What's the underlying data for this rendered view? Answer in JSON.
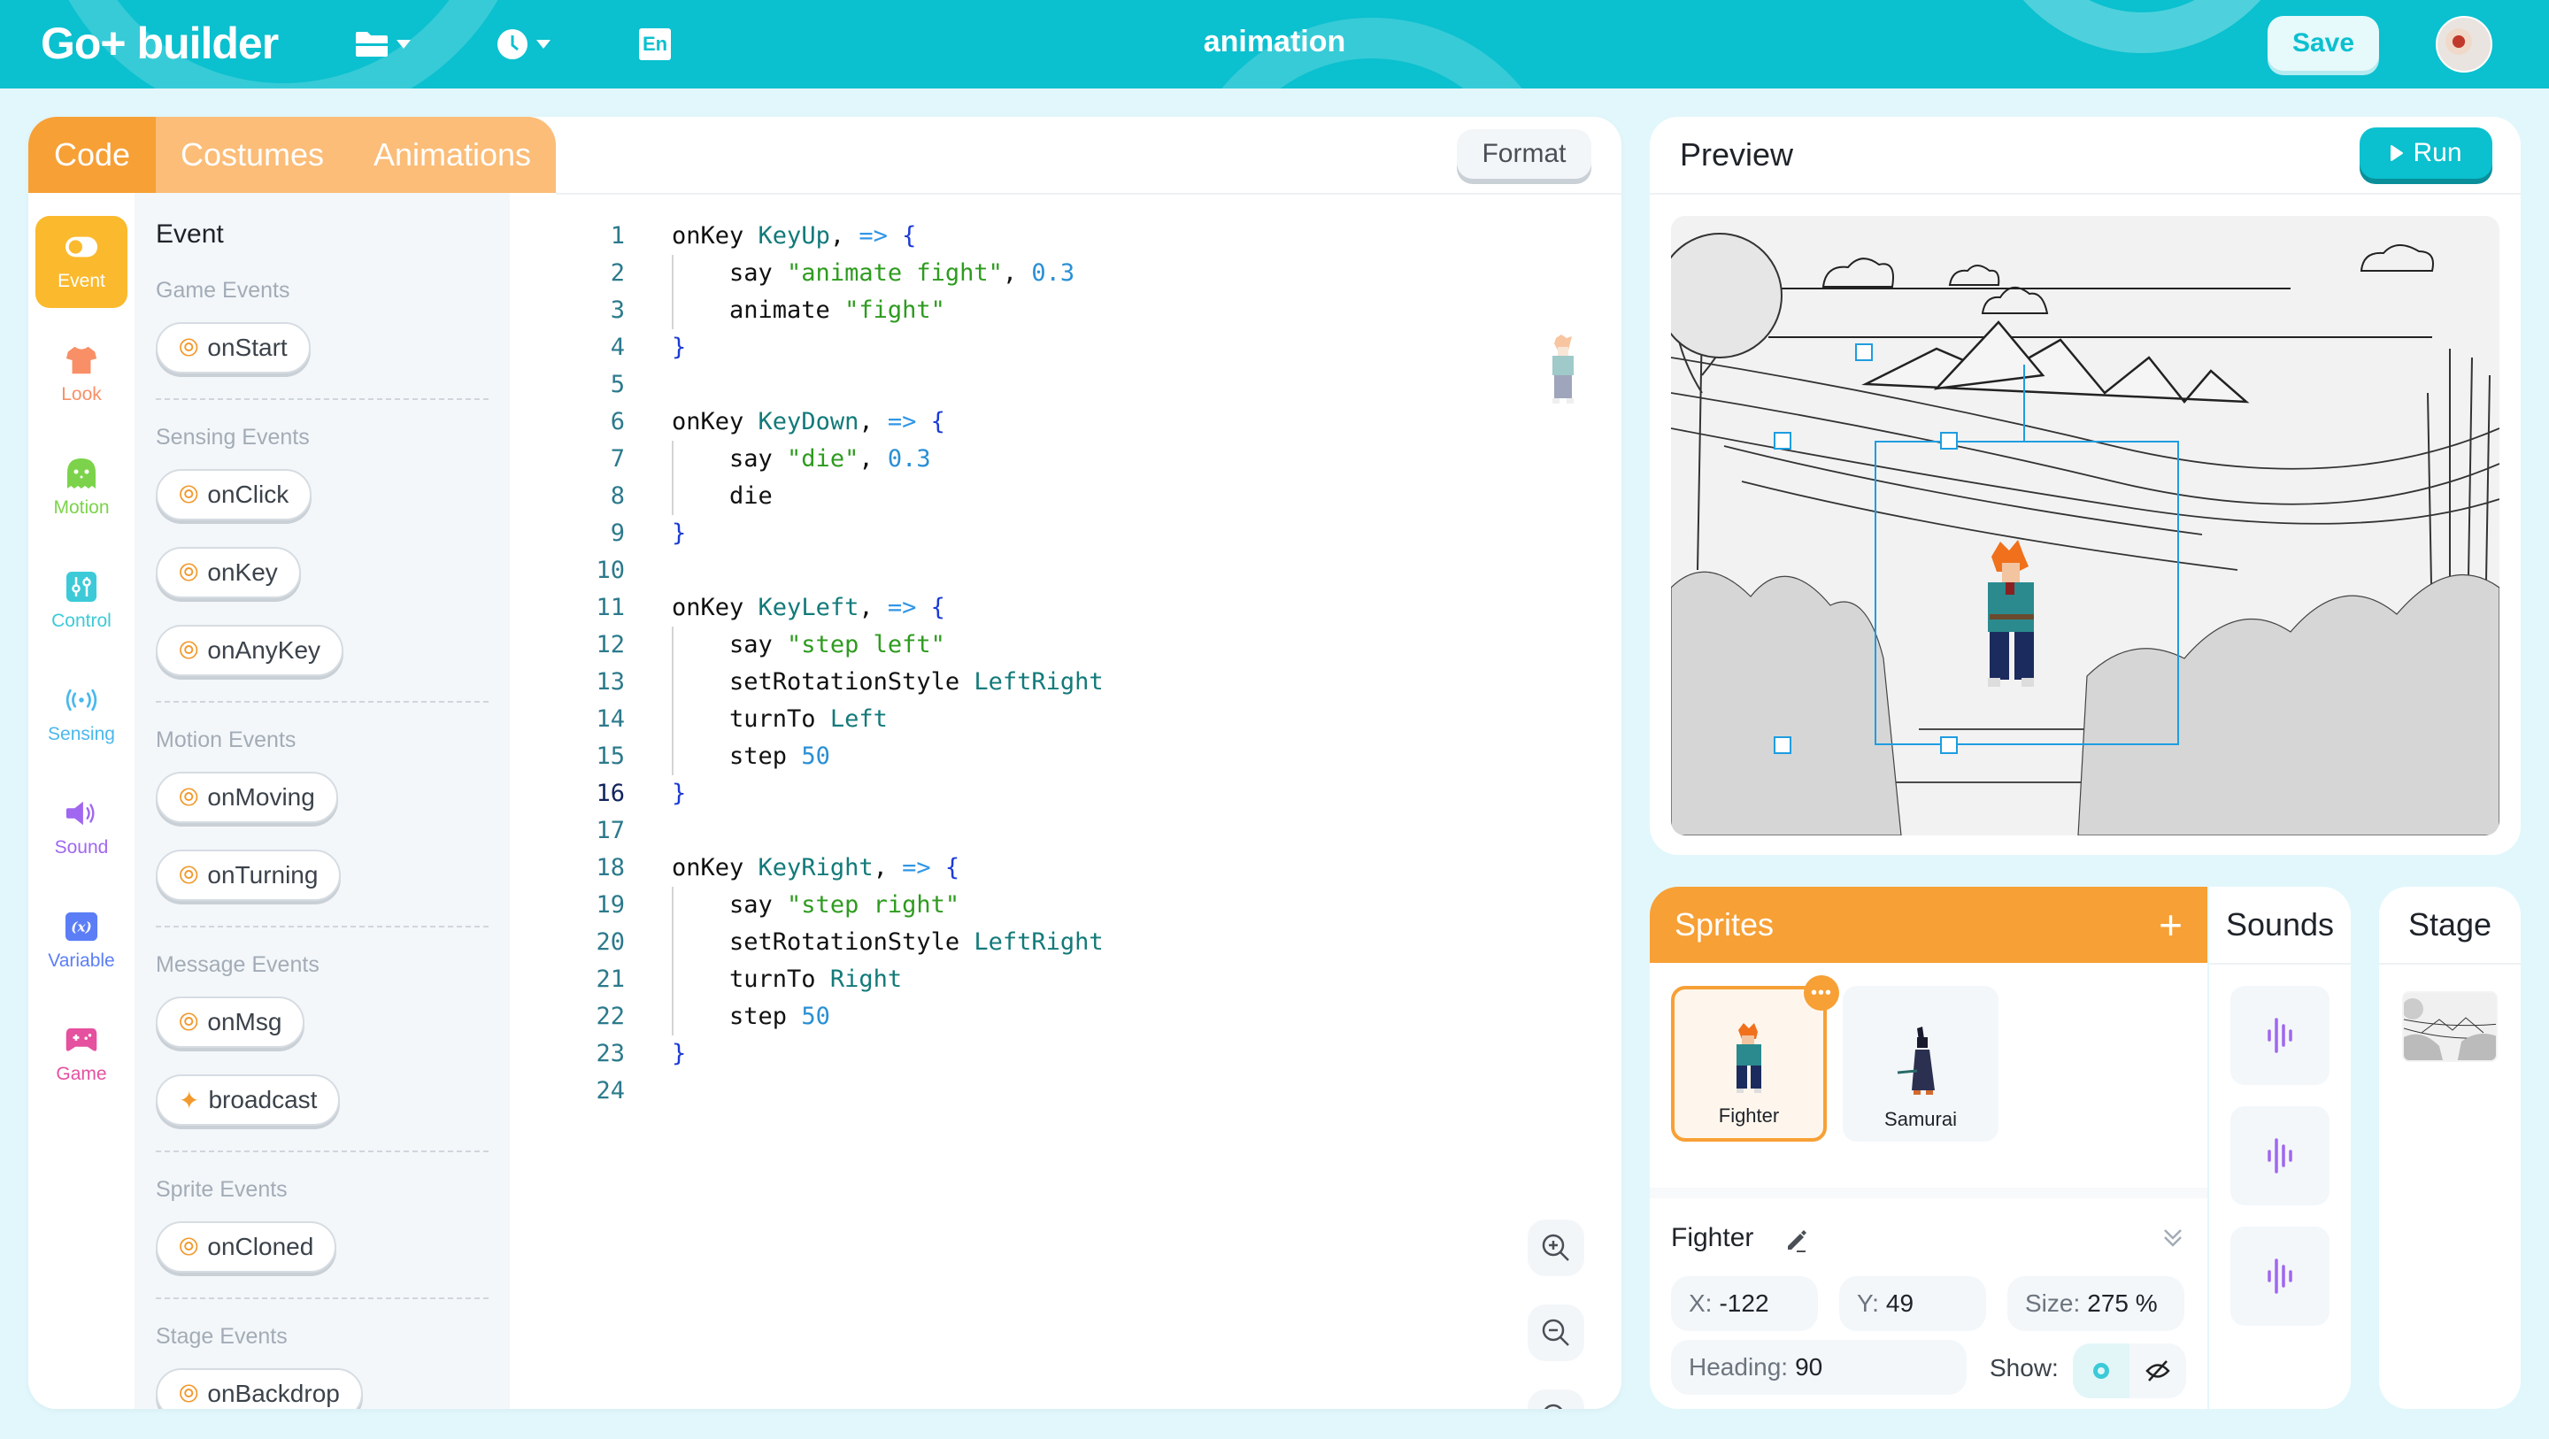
{
  "header": {
    "logo": "Go+ builder",
    "project_title": "animation",
    "language_badge": "En",
    "save_label": "Save",
    "icons": [
      "folder-icon",
      "history-clock-icon",
      "language-icon"
    ]
  },
  "code_panel": {
    "tabs": [
      {
        "label": "Code",
        "active": true
      },
      {
        "label": "Costumes",
        "active": false
      },
      {
        "label": "Animations",
        "active": false
      }
    ],
    "format_label": "Format",
    "categories": [
      {
        "label": "Event",
        "icon": "toggle-icon",
        "color": "#fbb92d",
        "active": true
      },
      {
        "label": "Look",
        "icon": "shirt-icon",
        "color": "#f88f66"
      },
      {
        "label": "Motion",
        "icon": "ghost-icon",
        "color": "#7cd34b"
      },
      {
        "label": "Control",
        "icon": "sliders-icon",
        "color": "#3ccad8"
      },
      {
        "label": "Sensing",
        "icon": "signal-icon",
        "color": "#4ab8ec"
      },
      {
        "label": "Sound",
        "icon": "speaker-icon",
        "color": "#a067f0"
      },
      {
        "label": "Variable",
        "icon": "variable-icon",
        "color": "#5b7ef6"
      },
      {
        "label": "Game",
        "icon": "gamepad-icon",
        "color": "#e5509f"
      }
    ],
    "palette": {
      "title": "Event",
      "sections": [
        {
          "title": "Game Events",
          "blocks": [
            "onStart"
          ]
        },
        {
          "title": "Sensing Events",
          "blocks": [
            "onClick",
            "onKey",
            "onAnyKey"
          ]
        },
        {
          "title": "Motion Events",
          "blocks": [
            "onMoving",
            "onTurning"
          ]
        },
        {
          "title": "Message Events",
          "blocks": [
            "onMsg",
            "broadcast"
          ]
        },
        {
          "title": "Sprite Events",
          "blocks": [
            "onCloned"
          ]
        },
        {
          "title": "Stage Events",
          "blocks": [
            "onBackdrop"
          ]
        }
      ]
    },
    "editor": {
      "current_line": 16,
      "lines": [
        [
          {
            "t": "onKey ",
            "c": "fn"
          },
          {
            "t": "KeyUp",
            "c": "const"
          },
          {
            "t": ", ",
            "c": "fn"
          },
          {
            "t": "=>",
            "c": "op"
          },
          {
            "t": " ",
            "c": "fn"
          },
          {
            "t": "{",
            "c": "brace"
          }
        ],
        [
          {
            "t": "    say ",
            "c": "fn"
          },
          {
            "t": "\"animate fight\"",
            "c": "str"
          },
          {
            "t": ", ",
            "c": "fn"
          },
          {
            "t": "0.3",
            "c": "num"
          }
        ],
        [
          {
            "t": "    animate ",
            "c": "fn"
          },
          {
            "t": "\"fight\"",
            "c": "str"
          }
        ],
        [
          {
            "t": "}",
            "c": "brace"
          }
        ],
        [],
        [
          {
            "t": "onKey ",
            "c": "fn"
          },
          {
            "t": "KeyDown",
            "c": "const"
          },
          {
            "t": ", ",
            "c": "fn"
          },
          {
            "t": "=>",
            "c": "op"
          },
          {
            "t": " ",
            "c": "fn"
          },
          {
            "t": "{",
            "c": "brace"
          }
        ],
        [
          {
            "t": "    say ",
            "c": "fn"
          },
          {
            "t": "\"die\"",
            "c": "str"
          },
          {
            "t": ", ",
            "c": "fn"
          },
          {
            "t": "0.3",
            "c": "num"
          }
        ],
        [
          {
            "t": "    die",
            "c": "fn"
          }
        ],
        [
          {
            "t": "}",
            "c": "brace"
          }
        ],
        [],
        [
          {
            "t": "onKey ",
            "c": "fn"
          },
          {
            "t": "KeyLeft",
            "c": "const"
          },
          {
            "t": ", ",
            "c": "fn"
          },
          {
            "t": "=>",
            "c": "op"
          },
          {
            "t": " ",
            "c": "fn"
          },
          {
            "t": "{",
            "c": "brace"
          }
        ],
        [
          {
            "t": "    say ",
            "c": "fn"
          },
          {
            "t": "\"step left\"",
            "c": "str"
          }
        ],
        [
          {
            "t": "    setRotationStyle ",
            "c": "fn"
          },
          {
            "t": "LeftRight",
            "c": "const"
          }
        ],
        [
          {
            "t": "    turnTo ",
            "c": "fn"
          },
          {
            "t": "Left",
            "c": "const"
          }
        ],
        [
          {
            "t": "    step ",
            "c": "fn"
          },
          {
            "t": "50",
            "c": "num"
          }
        ],
        [
          {
            "t": "}",
            "c": "brace"
          }
        ],
        [],
        [
          {
            "t": "onKey ",
            "c": "fn"
          },
          {
            "t": "KeyRight",
            "c": "const"
          },
          {
            "t": ", ",
            "c": "fn"
          },
          {
            "t": "=>",
            "c": "op"
          },
          {
            "t": " ",
            "c": "fn"
          },
          {
            "t": "{",
            "c": "brace"
          }
        ],
        [
          {
            "t": "    say ",
            "c": "fn"
          },
          {
            "t": "\"step right\"",
            "c": "str"
          }
        ],
        [
          {
            "t": "    setRotationStyle ",
            "c": "fn"
          },
          {
            "t": "LeftRight",
            "c": "const"
          }
        ],
        [
          {
            "t": "    turnTo ",
            "c": "fn"
          },
          {
            "t": "Right",
            "c": "const"
          }
        ],
        [
          {
            "t": "    step ",
            "c": "fn"
          },
          {
            "t": "50",
            "c": "num"
          }
        ],
        [
          {
            "t": "}",
            "c": "brace"
          }
        ],
        []
      ],
      "zoom_controls": [
        "zoom-in-icon",
        "zoom-out-icon",
        "zoom-reset-icon"
      ]
    }
  },
  "preview": {
    "title": "Preview",
    "run_label": "Run"
  },
  "sprites": {
    "title": "Sprites",
    "add_label": "+",
    "items": [
      {
        "name": "Fighter",
        "selected": true
      },
      {
        "name": "Samurai",
        "selected": false
      }
    ],
    "more_label": "•••",
    "selected": {
      "name": "Fighter",
      "x_label": "X:",
      "x": "-122",
      "y_label": "Y:",
      "y": "49",
      "size_label": "Size:",
      "size": "275 %",
      "heading_label": "Heading:",
      "heading": "90",
      "show_label": "Show:",
      "visible": true
    }
  },
  "sounds": {
    "title": "Sounds",
    "count": 3
  },
  "stage": {
    "title": "Stage"
  },
  "colors": {
    "brand": "#0bc0cf",
    "accent_orange": "#f7a035",
    "selection_blue": "#1e9de0"
  }
}
